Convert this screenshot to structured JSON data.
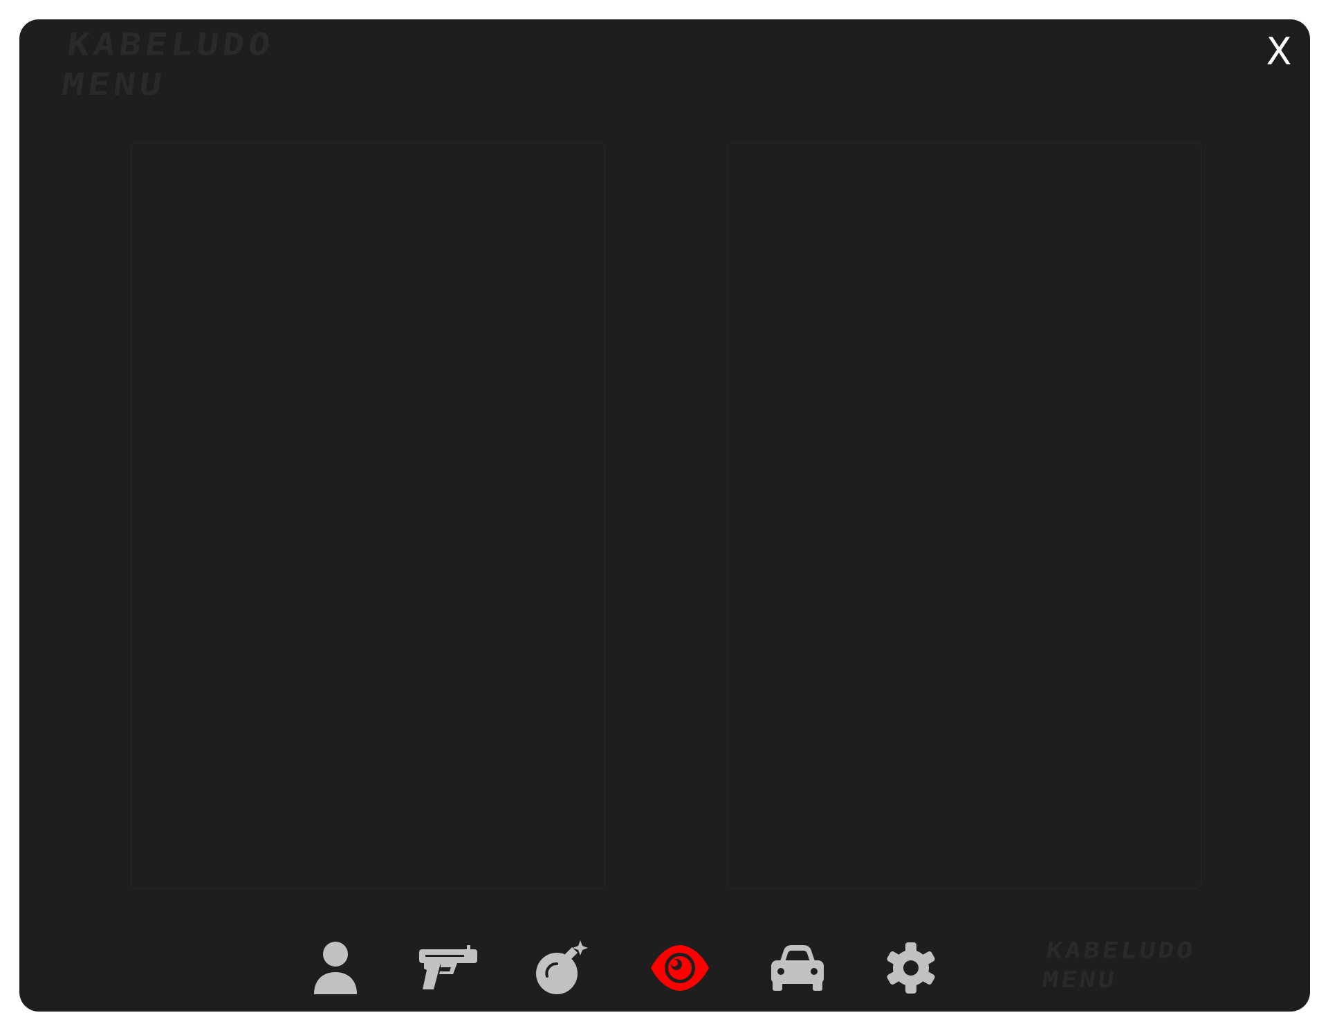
{
  "brand": {
    "logo_line1": "KABELUDO",
    "logo_line2": "MENU"
  },
  "window": {
    "close_label": "X"
  },
  "nav": {
    "items": [
      {
        "icon": "user-icon",
        "active": false
      },
      {
        "icon": "pistol-icon",
        "active": false
      },
      {
        "icon": "bomb-icon",
        "active": false
      },
      {
        "icon": "eye-icon",
        "active": true
      },
      {
        "icon": "car-icon",
        "active": false
      },
      {
        "icon": "gear-icon",
        "active": false
      }
    ]
  },
  "colors": {
    "background": "#1e1e1e",
    "icon_inactive": "#c2c2c2",
    "icon_active": "#ff0000",
    "logo": "#2a2a2a"
  }
}
